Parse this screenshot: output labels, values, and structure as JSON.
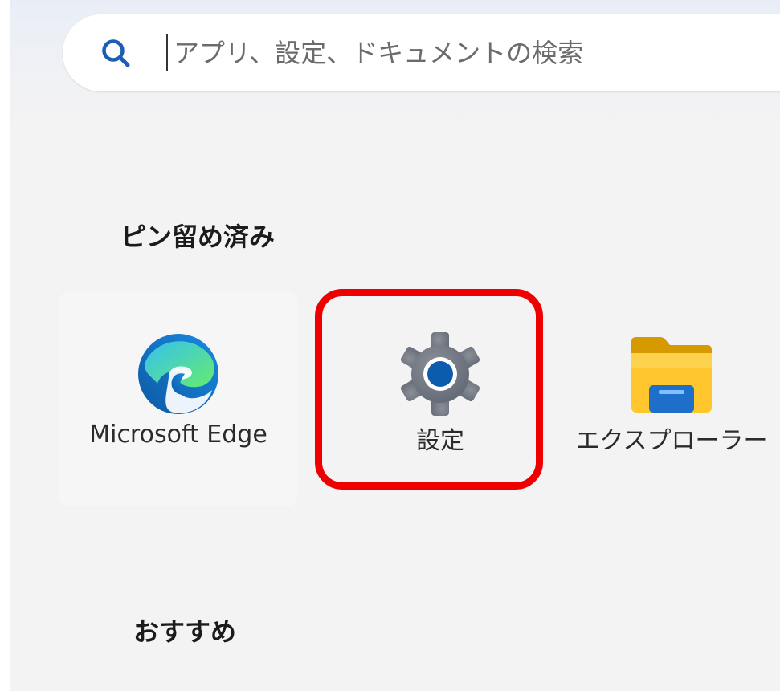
{
  "search": {
    "placeholder": "アプリ、設定、ドキュメントの検索",
    "icon": "search-icon"
  },
  "pinned": {
    "title": "ピン留め済み",
    "apps": [
      {
        "label": "Microsoft Edge",
        "icon": "edge-icon"
      },
      {
        "label": "設定",
        "icon": "settings-gear-icon",
        "highlighted": true
      },
      {
        "label": "エクスプローラー",
        "icon": "folder-icon"
      }
    ]
  },
  "recommended": {
    "title": "おすすめ"
  },
  "colors": {
    "highlight": "#ef0000",
    "search_icon": "#1a5fb4",
    "panel_bg": "#f3f3f3"
  }
}
